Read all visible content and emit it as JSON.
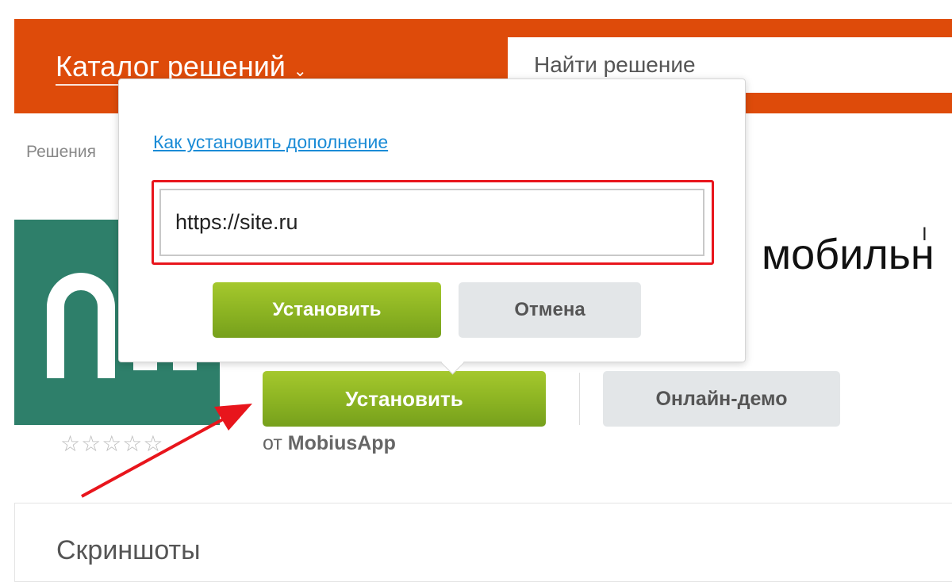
{
  "header": {
    "catalog_label": "Каталог решений",
    "search_placeholder": "Найти решение",
    "color": "#de4b0a"
  },
  "breadcrumb": "Решения",
  "app": {
    "title_fragment": "мобильн",
    "developer_prefix": "от",
    "developer_name": "MobiusApp",
    "rating_stars": "☆☆☆☆☆",
    "rating": 0,
    "logo_color": "#2e7f6a"
  },
  "actions": {
    "install_label": "Установить",
    "demo_label": "Онлайн-демо"
  },
  "popup": {
    "help_link": "Как установить дополнение",
    "url_value": "https://site.ru",
    "install_label": "Установить",
    "cancel_label": "Отмена"
  },
  "sections": {
    "screenshots_title": "Скриншоты"
  },
  "annotation": {
    "arrow_color": "#e8151c",
    "highlight_color": "#e8151c"
  }
}
